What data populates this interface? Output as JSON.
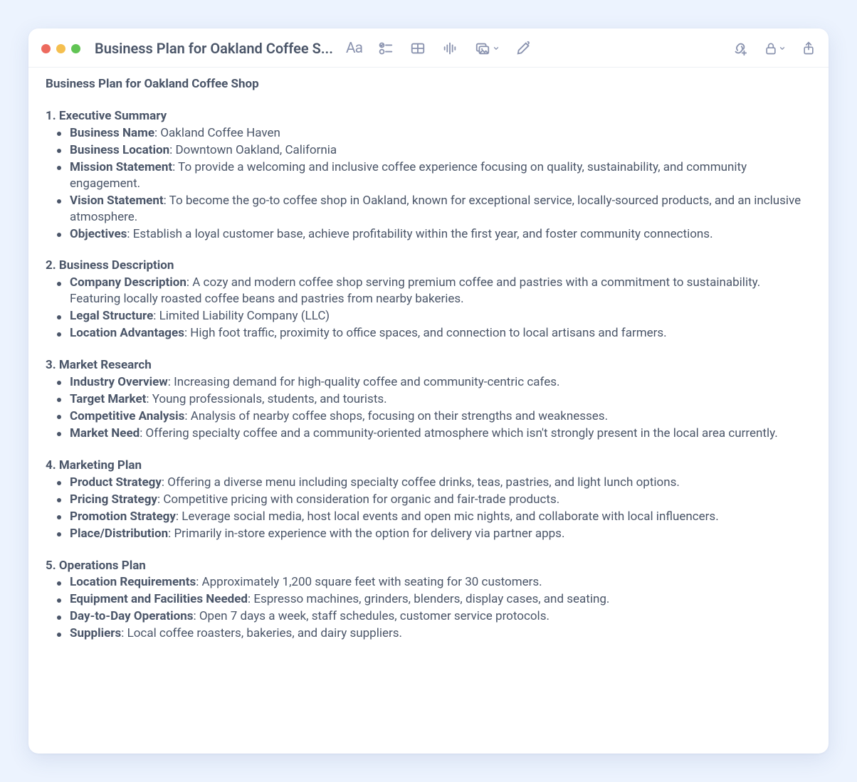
{
  "window": {
    "title_truncated": "Business Plan for Oakland Coffee S..."
  },
  "toolbar_icon_names": [
    "format-text",
    "checklist",
    "table",
    "audio-waveform",
    "image",
    "draw-pen",
    "link-add",
    "lock",
    "share"
  ],
  "document": {
    "title": "Business Plan for Oakland Coffee Shop",
    "sections": [
      {
        "heading": "1. Executive Summary",
        "items": [
          {
            "label": "Business Name",
            "text": "Oakland Coffee Haven"
          },
          {
            "label": "Business Location",
            "text": "Downtown Oakland, California"
          },
          {
            "label": "Mission Statement",
            "text": "To provide a welcoming and inclusive coffee experience focusing on quality, sustainability, and community engagement."
          },
          {
            "label": "Vision Statement",
            "text": "To become the go-to coffee shop in Oakland, known for exceptional service, locally-sourced products, and an inclusive atmosphere."
          },
          {
            "label": "Objectives",
            "text": "Establish a loyal customer base, achieve profitability within the first year, and foster community connections."
          }
        ]
      },
      {
        "heading": "2. Business Description",
        "items": [
          {
            "label": "Company Description",
            "text": "A cozy and modern coffee shop serving premium coffee and pastries with a commitment to sustainability. Featuring locally roasted coffee beans and pastries from nearby bakeries."
          },
          {
            "label": "Legal Structure",
            "text": "Limited Liability Company (LLC)"
          },
          {
            "label": "Location Advantages",
            "text": "High foot traffic, proximity to office spaces, and connection to local artisans and farmers."
          }
        ]
      },
      {
        "heading": "3. Market Research",
        "items": [
          {
            "label": "Industry Overview",
            "text": "Increasing demand for high-quality coffee and community-centric cafes."
          },
          {
            "label": "Target Market",
            "text": "Young professionals, students, and tourists."
          },
          {
            "label": "Competitive Analysis",
            "text": "Analysis of nearby coffee shops, focusing on their strengths and weaknesses."
          },
          {
            "label": "Market Need",
            "text": "Offering specialty coffee and a community-oriented atmosphere which isn't strongly present in the local area currently."
          }
        ]
      },
      {
        "heading": "4. Marketing Plan",
        "items": [
          {
            "label": "Product Strategy",
            "text": "Offering a diverse menu including specialty coffee drinks, teas, pastries, and light lunch options."
          },
          {
            "label": "Pricing Strategy",
            "text": "Competitive pricing with consideration for organic and fair-trade products."
          },
          {
            "label": "Promotion Strategy",
            "text": "Leverage social media, host local events and open mic nights, and collaborate with local influencers."
          },
          {
            "label": "Place/Distribution",
            "text": "Primarily in-store experience with the option for delivery via partner apps."
          }
        ]
      },
      {
        "heading": "5. Operations Plan",
        "items": [
          {
            "label": "Location Requirements",
            "text": "Approximately 1,200 square feet with seating for 30 customers."
          },
          {
            "label": "Equipment and Facilities Needed",
            "text": "Espresso machines, grinders, blenders, display cases, and seating."
          },
          {
            "label": "Day-to-Day Operations",
            "text": "Open 7 days a week, staff schedules, customer service protocols."
          },
          {
            "label": "Suppliers",
            "text": "Local coffee roasters, bakeries, and dairy suppliers."
          }
        ]
      }
    ]
  }
}
